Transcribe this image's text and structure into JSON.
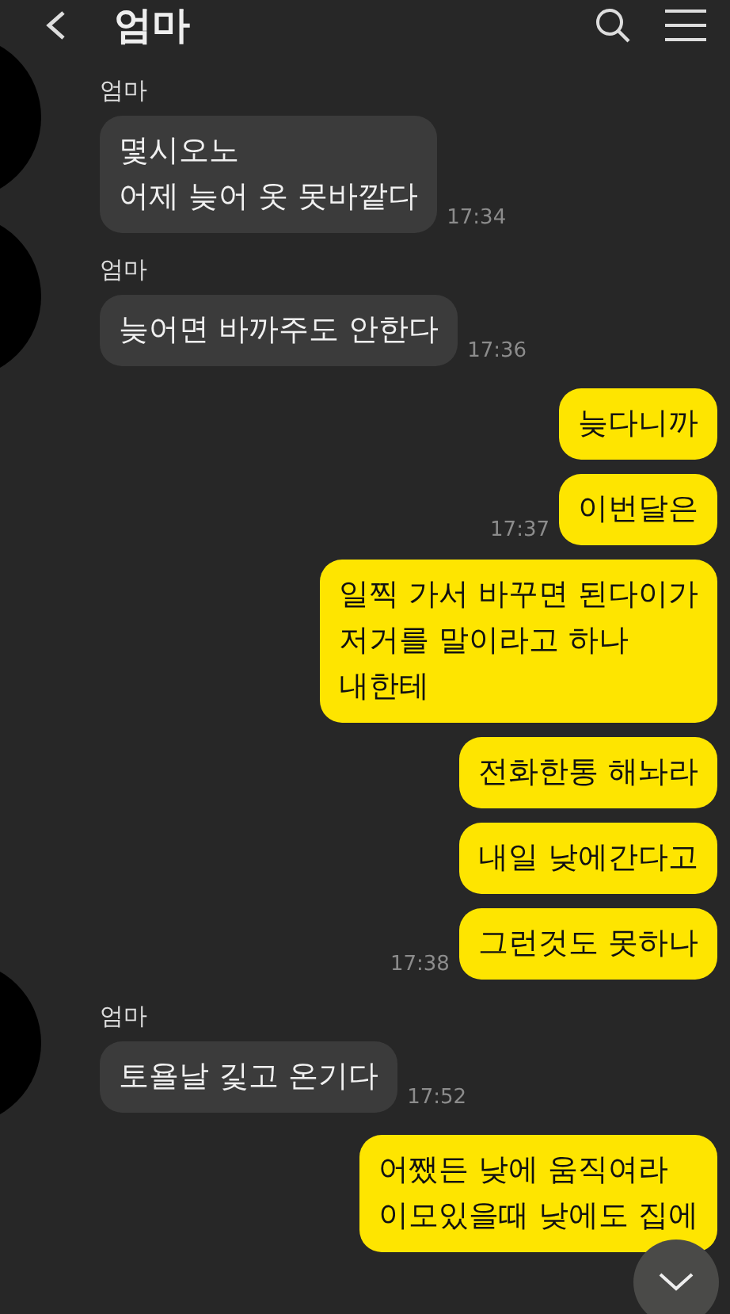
{
  "header": {
    "title": "엄마"
  },
  "groups": [
    {
      "kind": "received",
      "sender": "엄마",
      "messages": [
        {
          "text": "몇시오노\n어제 늦어 옷 못바깥다",
          "time": "17:34"
        }
      ]
    },
    {
      "kind": "received",
      "sender": "엄마",
      "messages": [
        {
          "text": "늦어면 바까주도 안한다",
          "time": "17:36"
        }
      ]
    },
    {
      "kind": "sent",
      "messages": [
        {
          "text": "늦다니까"
        },
        {
          "text": "이번달은",
          "time": "17:37"
        },
        {
          "text": "일찍 가서 바꾸면 된다이가\n저거를 말이라고 하나\n내한테"
        },
        {
          "text": "전화한통 해놔라"
        },
        {
          "text": "내일 낮에간다고"
        },
        {
          "text": "그런것도 못하나",
          "time": "17:38"
        }
      ]
    },
    {
      "kind": "received",
      "sender": "엄마",
      "messages": [
        {
          "text": "토욜날 깇고 온기다",
          "time": "17:52"
        }
      ]
    },
    {
      "kind": "sent",
      "messages": [
        {
          "text": "어쨌든 낮에 움직여라\n이모있을때 낮에도 집에"
        }
      ]
    }
  ]
}
